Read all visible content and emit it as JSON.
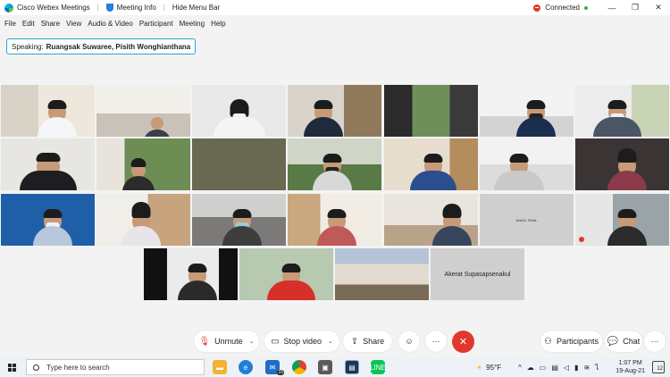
{
  "window": {
    "app_title": "Cisco Webex Meetings",
    "meeting_info": "Meeting Info",
    "hide_menu_bar": "Hide Menu Bar",
    "status": "Connected"
  },
  "menu": [
    "File",
    "Edit",
    "Share",
    "View",
    "Audio & Video",
    "Participant",
    "Meeting",
    "Help"
  ],
  "speaking": {
    "prefix": "Speaking:",
    "names": "Ruangsak Suwaree, Pisith Wonghianthana"
  },
  "tiles": {
    "named_1": "ANAN. RNAL",
    "named_2": "Akerat Supasapsenakul"
  },
  "controls": {
    "unmute": "Unmute",
    "stop_video": "Stop video",
    "share": "Share",
    "participants": "Participants",
    "chat": "Chat"
  },
  "taskbar": {
    "search_placeholder": "Type here to search",
    "mail_badge": "15",
    "temperature": "95°F",
    "time": "1:07 PM",
    "date": "19-Aug-21",
    "notifications": "12"
  },
  "colors": {
    "accent": "#27a5d8",
    "danger": "#e0392c",
    "online": "#2fb04a"
  }
}
